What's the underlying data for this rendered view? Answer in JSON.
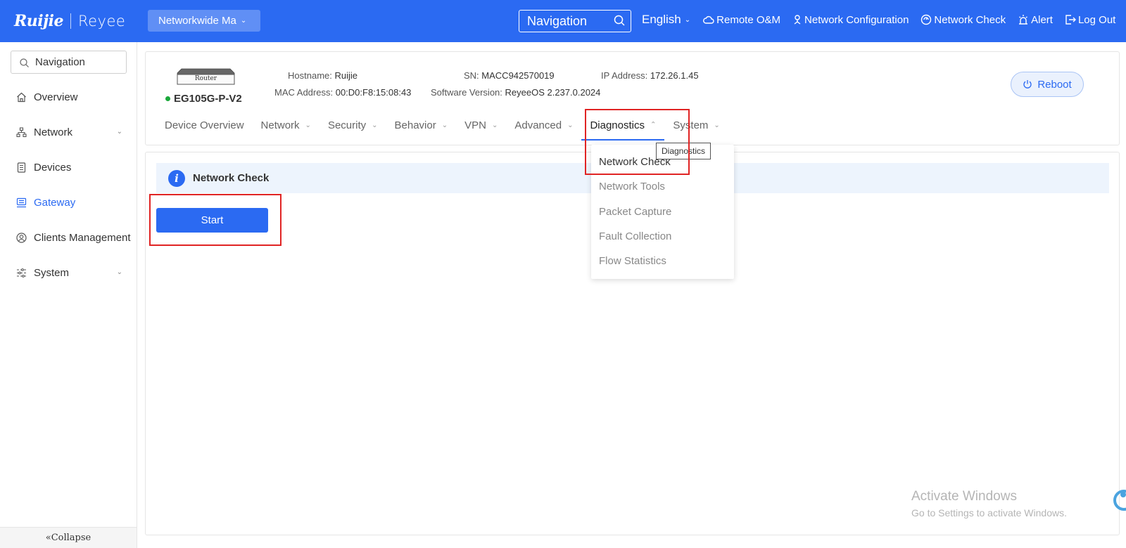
{
  "topbar": {
    "logo_primary": "Ruijie",
    "logo_secondary": "Reyee",
    "network_selector": "Networkwide Ma",
    "search_placeholder": "Navigation",
    "language": "English",
    "remote_om": "Remote O&M",
    "network_configuration": "Network Configuration",
    "network_check": "Network Check",
    "alert": "Alert",
    "logout": "Log Out"
  },
  "sidebar": {
    "search_placeholder": "Navigation",
    "items": [
      {
        "label": "Overview"
      },
      {
        "label": "Network"
      },
      {
        "label": "Devices"
      },
      {
        "label": "Gateway"
      },
      {
        "label": "Clients Management"
      },
      {
        "label": "System"
      }
    ],
    "collapse": "Collapse"
  },
  "device": {
    "image_label": "Router",
    "model": "EG105G-P-V2",
    "hostname_label": "Hostname:",
    "hostname": "Ruijie",
    "sn_label": "SN:",
    "sn": "MACC942570019",
    "ip_label": "IP Address:",
    "ip": "172.26.1.45",
    "mac_label": "MAC Address:",
    "mac": "00:D0:F8:15:08:43",
    "sw_label": "Software Version:",
    "sw": "ReyeeOS 2.237.0.2024",
    "reboot": "Reboot"
  },
  "tabs": [
    {
      "label": "Device Overview"
    },
    {
      "label": "Network"
    },
    {
      "label": "Security"
    },
    {
      "label": "Behavior"
    },
    {
      "label": "VPN"
    },
    {
      "label": "Advanced"
    },
    {
      "label": "Diagnostics"
    },
    {
      "label": "System"
    }
  ],
  "dropdown": {
    "items": [
      {
        "label": "Network Check"
      },
      {
        "label": "Network Tools"
      },
      {
        "label": "Packet Capture"
      },
      {
        "label": "Fault Collection"
      },
      {
        "label": "Flow Statistics"
      }
    ],
    "tooltip": "Diagnostics"
  },
  "main": {
    "notice_title": "Network Check",
    "start_button": "Start"
  },
  "watermark": {
    "line1": "Activate Windows",
    "line2": "Go to Settings to activate Windows."
  },
  "colors": {
    "primary": "#2b6af2",
    "highlight": "#e02424",
    "online": "#1aa83a"
  }
}
